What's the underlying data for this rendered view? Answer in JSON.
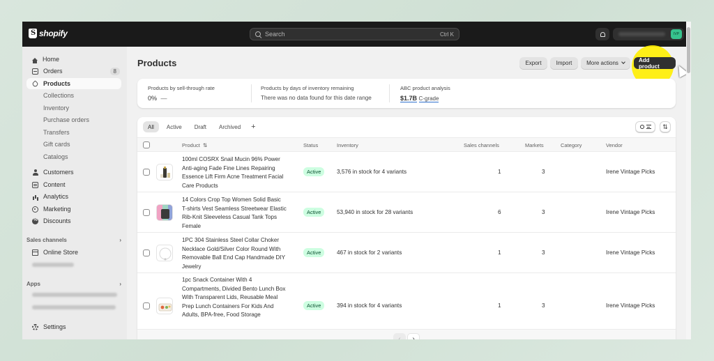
{
  "topbar": {
    "logo_text": "shopify",
    "search_placeholder": "Search",
    "search_shortcut": "Ctrl K",
    "avatar_initials": "IVP"
  },
  "sidebar": {
    "home": "Home",
    "orders": "Orders",
    "orders_badge": "8",
    "products": "Products",
    "collections": "Collections",
    "inventory": "Inventory",
    "purchase_orders": "Purchase orders",
    "transfers": "Transfers",
    "gift_cards": "Gift cards",
    "catalogs": "Catalogs",
    "customers": "Customers",
    "content": "Content",
    "analytics": "Analytics",
    "marketing": "Marketing",
    "discounts": "Discounts",
    "sales_channels": "Sales channels",
    "online_store": "Online Store",
    "apps": "Apps",
    "settings": "Settings",
    "chevron": "›"
  },
  "header": {
    "title": "Products",
    "export": "Export",
    "import": "Import",
    "more_actions": "More actions",
    "add_product": "Add product"
  },
  "analytics": {
    "sell_through_label": "Products by sell-through rate",
    "sell_through_value": "0%",
    "sell_through_dash": "—",
    "days_inventory_label": "Products by days of inventory remaining",
    "days_inventory_value": "There was no data found for this date range",
    "abc_label": "ABC product analysis",
    "abc_value": "$1.7B",
    "abc_grade": "C-grade"
  },
  "tabs": [
    "All",
    "Active",
    "Draft",
    "Archived"
  ],
  "tab_add": "+",
  "columns": {
    "product": "Product",
    "status": "Status",
    "inventory": "Inventory",
    "sales_channels": "Sales channels",
    "markets": "Markets",
    "category": "Category",
    "vendor": "Vendor"
  },
  "sort_glyph": "⇅",
  "rows": [
    {
      "name": "100ml COSRX Snail Mucin 96% Power Anti-aging Fade Fine Lines Repairing Essence Lift Firm Acne Treatment Facial Care Products",
      "status": "Active",
      "inventory": "3,576 in stock for 4 variants",
      "sales_channels": "1",
      "markets": "3",
      "category": "",
      "vendor": "Irene Vintage Picks"
    },
    {
      "name": "14 Colors Crop Top Women Solid Basic T-shirts Vest Seamless Streetwear Elastic Rib-Knit Sleeveless Casual Tank Tops Female",
      "status": "Active",
      "inventory": "53,940 in stock for 28 variants",
      "sales_channels": "6",
      "markets": "3",
      "category": "",
      "vendor": "Irene Vintage Picks"
    },
    {
      "name": "1PC 304 Stainless Steel Collar Choker Necklace Gold/Silver Color Round With Removable Ball End Cap Handmade DIY Jewelry",
      "status": "Active",
      "inventory": "467 in stock for 2 variants",
      "sales_channels": "1",
      "markets": "3",
      "category": "",
      "vendor": "Irene Vintage Picks"
    },
    {
      "name": "1pc Snack Container With 4 Compartments, Divided Bento Lunch Box With Transparent Lids, Reusable Meal Prep Lunch Containers For Kids And Adults, BPA-free, Food Storage",
      "status": "Active",
      "inventory": "394 in stock for 4 variants",
      "sales_channels": "1",
      "markets": "3",
      "category": "",
      "vendor": "Irene Vintage Picks"
    }
  ],
  "pager": {
    "prev": "‹",
    "next": "›"
  },
  "colors": {
    "topbar": "#1a1a1a",
    "primary_button": "#303030",
    "status_active_bg": "#cdfee1",
    "status_active_text": "#0c5132",
    "highlight": "#ffee00",
    "avatar": "#36c38d"
  }
}
